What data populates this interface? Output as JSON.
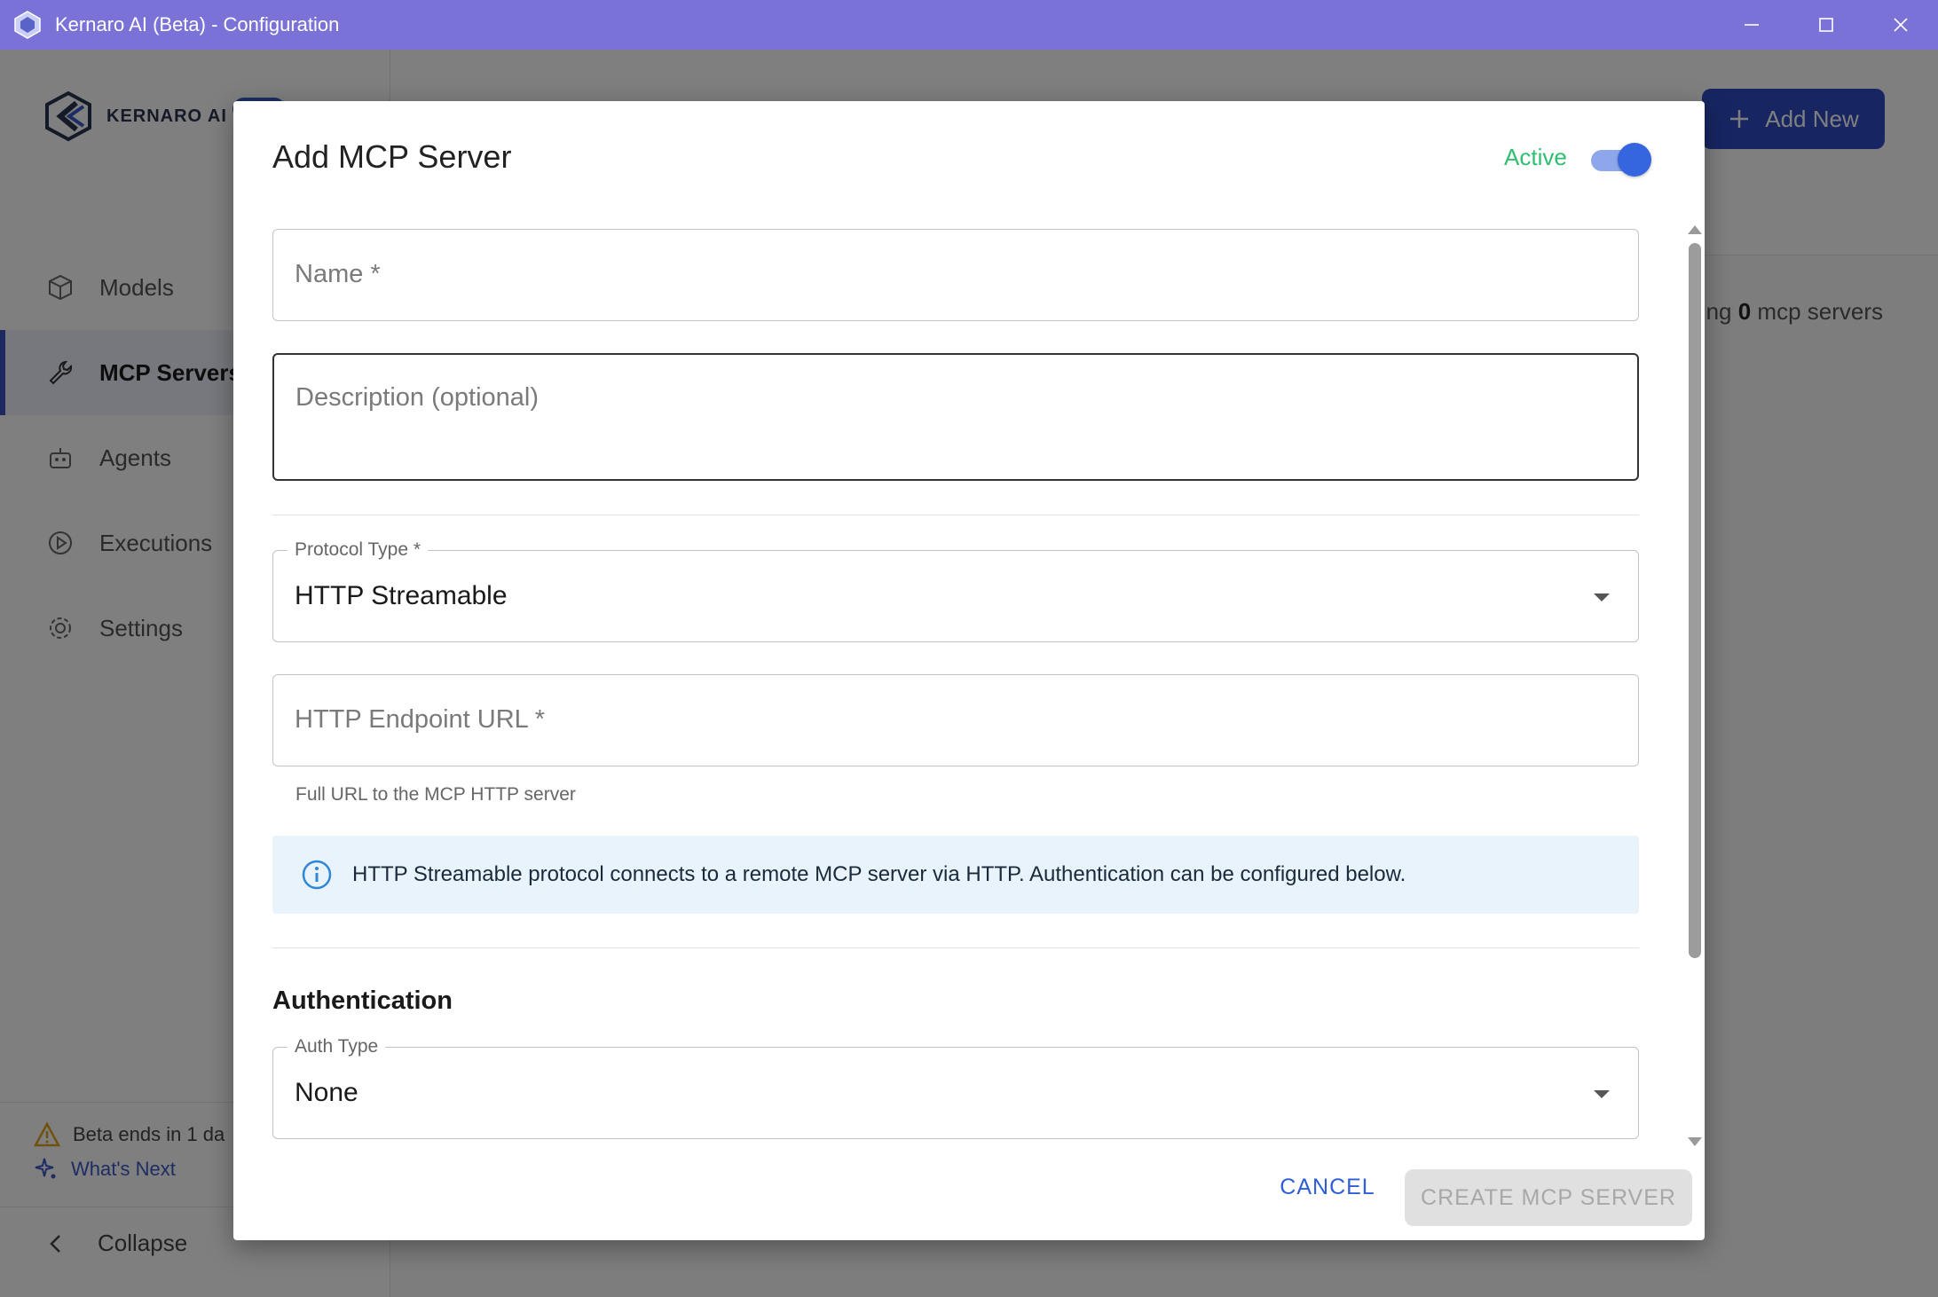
{
  "window": {
    "title": "Kernaro AI (Beta) - Configuration",
    "minimize_icon": "minimize-icon",
    "maximize_icon": "maximize-icon",
    "close_icon": "close-icon"
  },
  "brand": {
    "logo_text": "KERNARO AI"
  },
  "sidebar": {
    "items": [
      {
        "label": "Models",
        "icon": "cube-icon"
      },
      {
        "label": "MCP Servers",
        "icon": "wrench-icon",
        "active": true
      },
      {
        "label": "Agents",
        "icon": "robot-icon"
      },
      {
        "label": "Executions",
        "icon": "play-circle-icon"
      },
      {
        "label": "Settings",
        "icon": "gear-icon"
      }
    ],
    "beta_notice": "Beta ends in 1 da",
    "whats_next": "What's Next",
    "collapse": "Collapse"
  },
  "header": {
    "add_new": "Add New"
  },
  "main": {
    "showing_prefix": "ng",
    "showing_count": "0",
    "showing_suffix": "mcp servers"
  },
  "modal": {
    "title": "Add MCP Server",
    "active_label": "Active",
    "active": true,
    "name_placeholder": "Name *",
    "description_placeholder": "Description (optional)",
    "protocol_label": "Protocol Type *",
    "protocol_value": "HTTP Streamable",
    "endpoint_placeholder": "HTTP Endpoint URL *",
    "endpoint_helper": "Full URL to the MCP HTTP server",
    "info_text": "HTTP Streamable protocol connects to a remote MCP server via HTTP. Authentication can be configured below.",
    "auth_heading": "Authentication",
    "auth_type_label": "Auth Type",
    "auth_type_value": "None",
    "cancel": "CANCEL",
    "create": "CREATE MCP SERVER"
  },
  "colors": {
    "titlebar": "#7a72d6",
    "accent": "#2f4cc4",
    "active_green": "#2fbf71",
    "info_bg": "#e8f3fc"
  }
}
